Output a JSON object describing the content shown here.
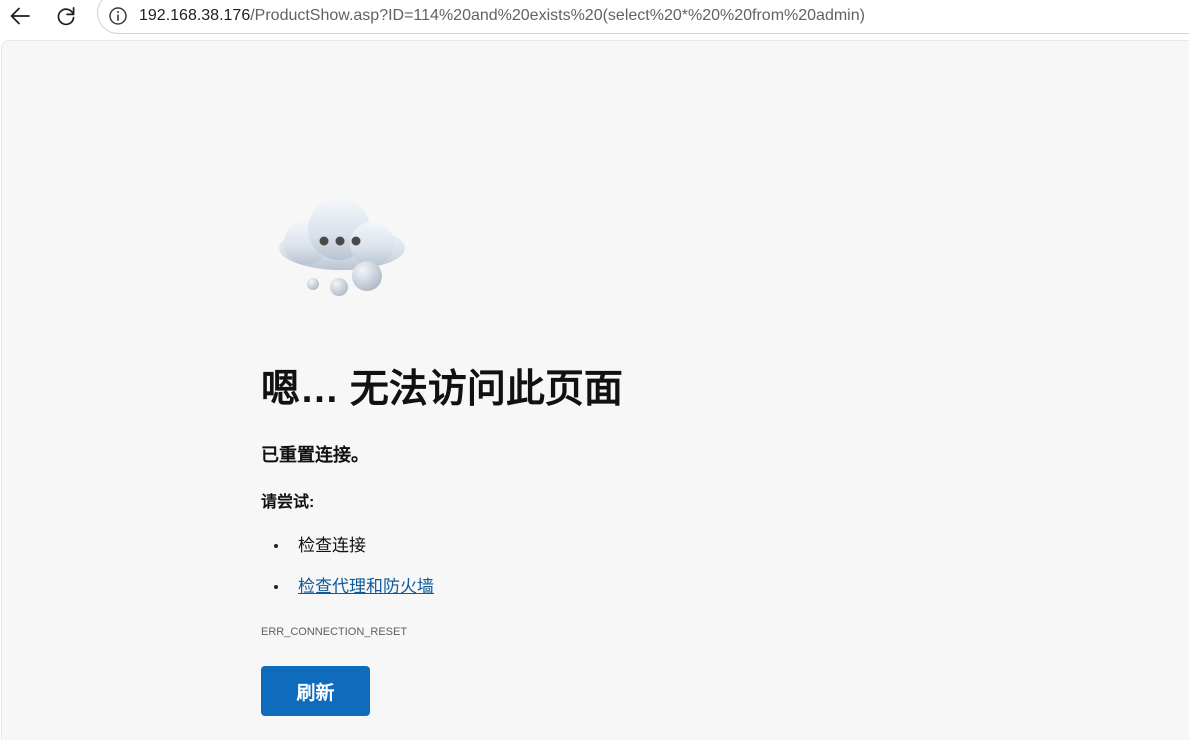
{
  "browser": {
    "back_icon": "back-arrow-icon",
    "reload_icon": "reload-icon",
    "info_icon": "info-icon",
    "url_host": "192.168.38.176",
    "url_path": "/ProductShow.asp?ID=114%20and%20exists%20(select%20*%20%20from%20admin)"
  },
  "error_page": {
    "illustration": "cloud-thinking-icon",
    "title": "嗯… 无法访问此页面",
    "subtitle": "已重置连接。",
    "try_label": "请尝试:",
    "suggestions": [
      {
        "label": "检查连接",
        "link": false
      },
      {
        "label": "检查代理和防火墙",
        "link": true
      }
    ],
    "error_code": "ERR_CONNECTION_RESET",
    "refresh_label": "刷新"
  },
  "colors": {
    "page_background": "#f7f7f7",
    "button": "#0f6cbd",
    "link": "#0e5a9c"
  }
}
